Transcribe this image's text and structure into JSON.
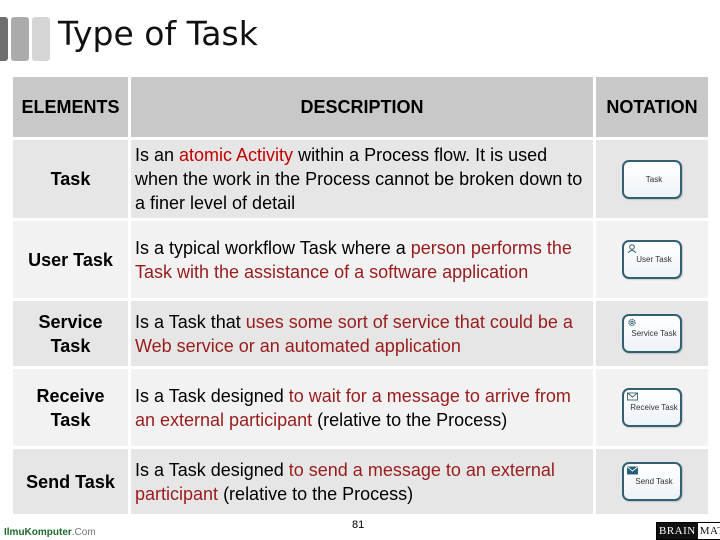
{
  "slide": {
    "title": "Type of Task",
    "page_number": "81"
  },
  "table": {
    "headers": [
      "ELEMENTS",
      "DESCRIPTION",
      "NOTATION"
    ],
    "rows": [
      {
        "element": "Task",
        "description": [
          {
            "text": "Is an ",
            "style": "normal"
          },
          {
            "text": "atomic Activity",
            "style": "red1"
          },
          {
            "text": " within a Process flow. It is used when the work in the Process cannot be broken down to a finer level of detail",
            "style": "normal"
          }
        ],
        "notation_label": "Task",
        "notation_icon": "none"
      },
      {
        "element": "User Task",
        "description": [
          {
            "text": "Is a typical workflow Task where a ",
            "style": "normal"
          },
          {
            "text": "person performs the Task with the assistance of a software application",
            "style": "red2"
          }
        ],
        "notation_label": "User Task",
        "notation_icon": "user-icon"
      },
      {
        "element": "Service Task",
        "description": [
          {
            "text": "Is a Task that ",
            "style": "normal"
          },
          {
            "text": "uses some sort of service that could be a Web service or an automated application",
            "style": "red2"
          }
        ],
        "notation_label": "Service Task",
        "notation_icon": "gear-icon"
      },
      {
        "element": "Receive Task",
        "description": [
          {
            "text": "Is a Task designed ",
            "style": "normal"
          },
          {
            "text": "to wait for a message to arrive from an external participant",
            "style": "red2"
          },
          {
            "text": " (relative to the Process)",
            "style": "normal"
          }
        ],
        "notation_label": "Receive Task",
        "notation_icon": "envelope-outline-icon"
      },
      {
        "element": "Send Task",
        "description": [
          {
            "text": "Is a Task designed ",
            "style": "normal"
          },
          {
            "text": "to send a message to an external participant",
            "style": "red2"
          },
          {
            "text": " (relative to the Process)",
            "style": "normal"
          }
        ],
        "notation_label": "Send Task",
        "notation_icon": "envelope-filled-icon"
      }
    ]
  },
  "footer": {
    "left_logo_main": "IlmuKomputer",
    "left_logo_domain": ".Com",
    "right_logo_a": "BRAIN",
    "right_logo_b": "MATICS"
  },
  "colors": {
    "header_bg": "#c8c8c8",
    "row_dark": "#e6e6e6",
    "row_light": "#f2f2f2",
    "accent_red_bright": "#c00000",
    "accent_red_dark": "#991c1c",
    "notation_border": "#335f72"
  }
}
